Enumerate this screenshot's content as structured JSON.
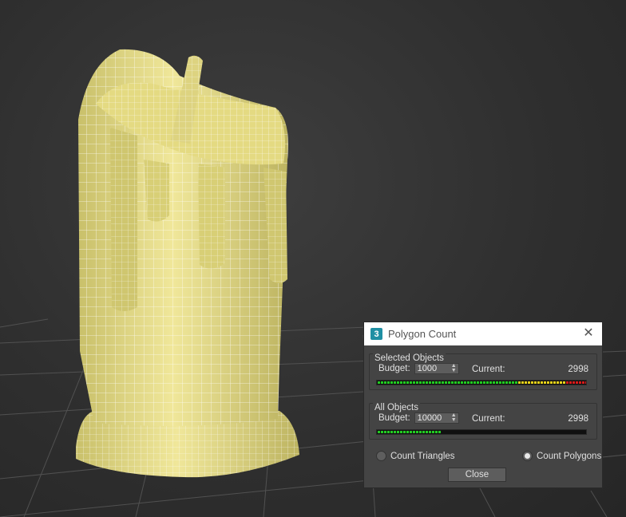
{
  "dialog": {
    "title": "Polygon Count",
    "app_icon_glyph": "3",
    "close_icon": "close-icon",
    "close_button_label": "Close",
    "selected": {
      "group_title": "Selected Objects",
      "budget_label": "Budget:",
      "budget_value": "1000",
      "current_label": "Current:",
      "current_value": "2998",
      "meter_fraction": 1.0
    },
    "all": {
      "group_title": "All Objects",
      "budget_label": "Budget:",
      "budget_value": "10000",
      "current_label": "Current:",
      "current_value": "2998",
      "meter_fraction": 0.3
    },
    "options": {
      "count_triangles_label": "Count Triangles",
      "count_polygons_label": "Count Polygons",
      "selected_option": "Count Polygons"
    }
  },
  "colors": {
    "model_fill": "#e8df8a",
    "wire": "#ffffff",
    "meter_green": "#22cc22",
    "meter_yellow": "#e8d21a",
    "meter_red": "#d81a1a",
    "title_icon": "#1f8fa3"
  }
}
